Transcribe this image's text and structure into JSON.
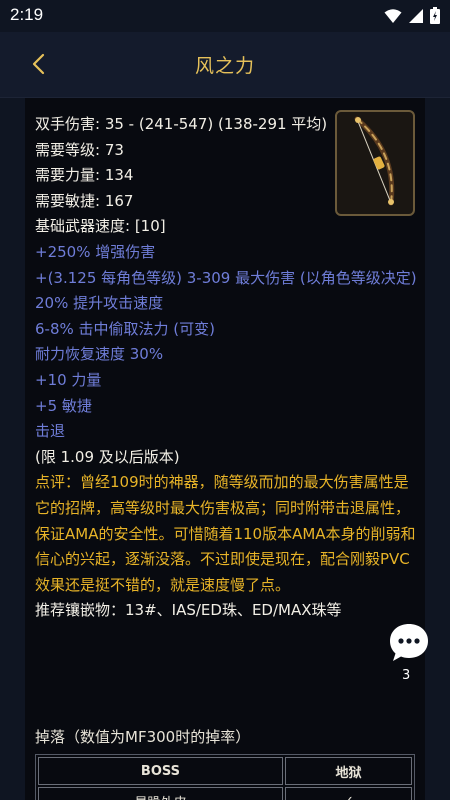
{
  "status": {
    "time": "2:19"
  },
  "header": {
    "title": "风之力"
  },
  "item": {
    "stats_white": [
      "双手伤害: 35 - (241-547) (138-291 平均)",
      "需要等级: 73",
      "需要力量: 134",
      "需要敏捷: 167",
      "基础武器速度: [10]"
    ],
    "stats_blue": [
      "+250% 增强伤害",
      "+(3.125 每角色等级) 3-309 最大伤害 (以角色等级决定)",
      "20% 提升攻击速度",
      "6-8% 击中偷取法力 (可变)",
      "耐力恢复速度 30%",
      "+10 力量",
      "+5 敏捷",
      "击退"
    ],
    "version_note": "(限 1.09 及以后版本)",
    "comment": "点评：曾经109时的神器，随等级而加的最大伤害属性是它的招牌，高等级时最大伤害极高；同时附带击退属性，保证AMA的安全性。可惜随着110版本AMA本身的削弱和信心的兴起，逐渐没落。不过即使是现在，配合刚毅PVC效果还是挺不错的，就是速度慢了点。",
    "recommend": "推荐镶嵌物：13#、IAS/ED珠、ED/MAX珠等"
  },
  "drop": {
    "title": "掉落（数值为MF300时的掉率）",
    "headers": [
      "BOSS",
      "地狱"
    ],
    "rows": [
      [
        "暴躁外皮",
        "✓"
      ]
    ]
  },
  "chat": {
    "count": "3"
  },
  "colors": {
    "accent": "#e6c15a",
    "magic": "#6f7dd8",
    "comment": "#e8b428"
  }
}
